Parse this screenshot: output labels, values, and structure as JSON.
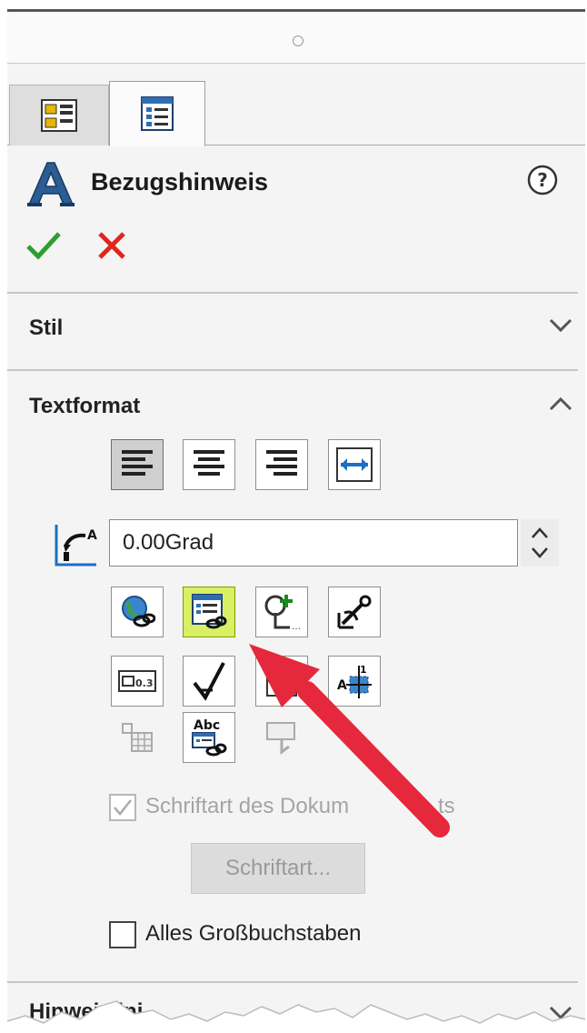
{
  "header": {
    "title": "Bezugshinweis"
  },
  "tabs": [
    {
      "name": "property-manager-tab"
    },
    {
      "name": "config-tab"
    }
  ],
  "sections": {
    "stil": {
      "label": "Stil",
      "state": "collapsed"
    },
    "textformat": {
      "label": "Textformat",
      "state": "expanded"
    },
    "hinweislinie": {
      "label": "Hinweislini",
      "state": "collapsed"
    }
  },
  "textformat": {
    "angle_value": "0.00Grad",
    "doc_font_label": "Schriftart des Dokum",
    "doc_font_label_tail": "ts",
    "font_button_label": "Schriftart...",
    "uppercase_label": "Alles Großbuchstaben",
    "stack_label": "1",
    "tolerance_label": "0.3",
    "abc_label": "Abc"
  },
  "colors": {
    "ok": "#2e9e2e",
    "cancel": "#e0261b",
    "highlight": "#d8ef66",
    "arrow": "#e5283c"
  }
}
